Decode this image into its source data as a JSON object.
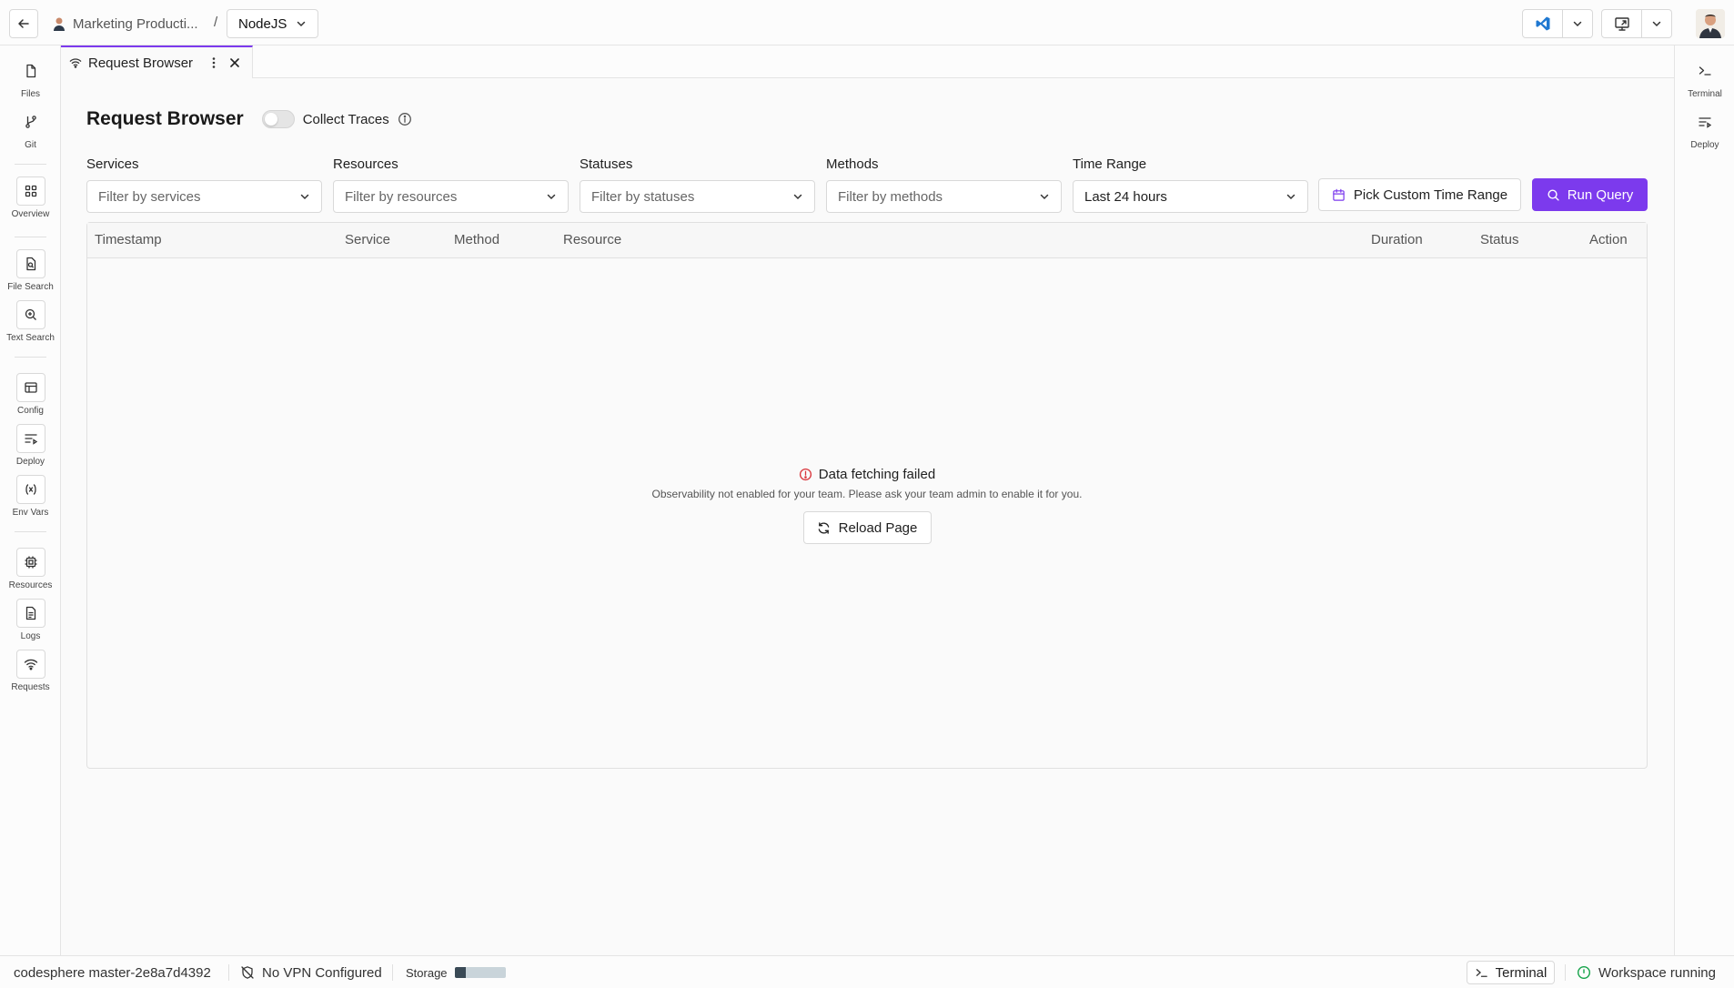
{
  "topbar": {
    "breadcrumb_team": "Marketing Producti...",
    "breadcrumb_separator": "/",
    "project": "NodeJS"
  },
  "left_rail": {
    "files": "Files",
    "git": "Git",
    "overview": "Overview",
    "file_search": "File Search",
    "text_search": "Text Search",
    "config": "Config",
    "deploy": "Deploy",
    "env_vars": "Env Vars",
    "resources": "Resources",
    "logs": "Logs",
    "requests": "Requests"
  },
  "right_rail": {
    "terminal": "Terminal",
    "deploy": "Deploy"
  },
  "tab": {
    "label": "Request Browser"
  },
  "page": {
    "title": "Request Browser",
    "collect_traces_label": "Collect Traces",
    "collect_traces_enabled": false
  },
  "filters": {
    "services": {
      "label": "Services",
      "placeholder": "Filter by services"
    },
    "resources": {
      "label": "Resources",
      "placeholder": "Filter by resources"
    },
    "statuses": {
      "label": "Statuses",
      "placeholder": "Filter by statuses"
    },
    "methods": {
      "label": "Methods",
      "placeholder": "Filter by methods"
    },
    "time_range": {
      "label": "Time Range",
      "value": "Last 24 hours"
    }
  },
  "actions": {
    "pick_custom_time_range": "Pick Custom Time Range",
    "run_query": "Run Query"
  },
  "table": {
    "columns": [
      "Timestamp",
      "Service",
      "Method",
      "Resource",
      "Duration",
      "Status",
      "Action"
    ]
  },
  "empty_state": {
    "title": "Data fetching failed",
    "message": "Observability not enabled for your team. Please ask your team admin to enable it for you.",
    "reload_label": "Reload Page"
  },
  "statusbar": {
    "branch": "codesphere master-2e8a7d4392",
    "vpn": "No VPN Configured",
    "storage_label": "Storage",
    "storage_used_fraction": 0.22,
    "terminal": "Terminal",
    "workspace_status": "Workspace running"
  },
  "colors": {
    "accent": "#7c3aed",
    "error": "#d9343a",
    "running": "#16a34a",
    "vscode_blue": "#1f78d1"
  }
}
